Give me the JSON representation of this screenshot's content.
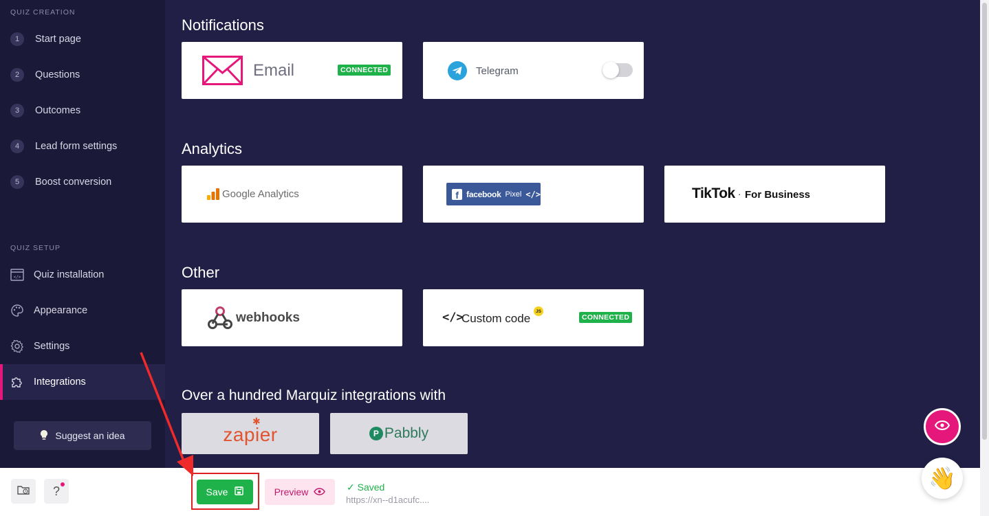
{
  "sidebar": {
    "quiz_creation_title": "QUIZ CREATION",
    "steps": [
      {
        "num": "1",
        "label": "Start page"
      },
      {
        "num": "2",
        "label": "Questions"
      },
      {
        "num": "3",
        "label": "Outcomes"
      },
      {
        "num": "4",
        "label": "Lead form settings"
      },
      {
        "num": "5",
        "label": "Boost conversion"
      }
    ],
    "quiz_setup_title": "QUIZ SETUP",
    "setup_items": [
      {
        "label": "Quiz installation",
        "icon": "code-window-icon"
      },
      {
        "label": "Appearance",
        "icon": "palette-icon"
      },
      {
        "label": "Settings",
        "icon": "gear-icon"
      },
      {
        "label": "Integrations",
        "icon": "puzzle-icon",
        "active": true
      }
    ],
    "suggest_label": "Suggest an idea"
  },
  "main": {
    "notifications_title": "Notifications",
    "email_label": "Email",
    "connected_badge": "CONNECTED",
    "telegram_label": "Telegram",
    "analytics_title": "Analytics",
    "google_analytics_label": "Google Analytics",
    "facebook_label": "facebook",
    "facebook_pixel_label": "Pixel",
    "tiktok_label": "TikTok",
    "tiktok_sub": "For Business",
    "other_title": "Other",
    "webhooks_label": "webhooks",
    "custom_code_label": "Custom code",
    "js_badge": "JS",
    "custom_connected_badge": "CONNECTED",
    "marquiz_title": "Over a hundred Marquiz integrations with",
    "zapier_label": "zapier",
    "pabbly_label": "Pabbly"
  },
  "bottom": {
    "save_label": "Save",
    "preview_label": "Preview",
    "saved_status": "✓ Saved",
    "saved_url": "https://xn--d1acufc...."
  },
  "colors": {
    "accent_pink": "#e5177b",
    "success_green": "#1fb24a",
    "bg_dark": "#221f46",
    "sidebar_bg": "#1b1938"
  }
}
